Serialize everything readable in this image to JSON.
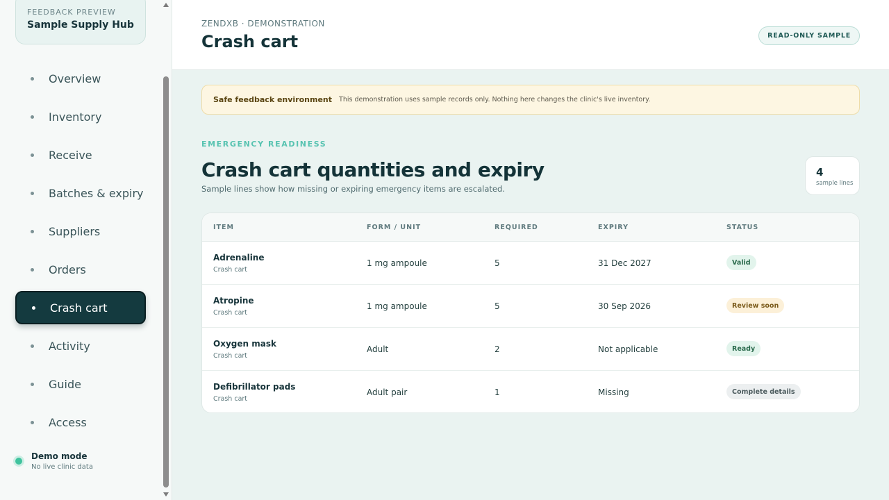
{
  "sidebar": {
    "eyebrow": "FEEDBACK PREVIEW",
    "title": "Sample Supply Hub",
    "items": [
      {
        "label": "Overview"
      },
      {
        "label": "Inventory"
      },
      {
        "label": "Receive"
      },
      {
        "label": "Batches & expiry"
      },
      {
        "label": "Suppliers"
      },
      {
        "label": "Orders"
      },
      {
        "label": "Crash cart",
        "active": true
      },
      {
        "label": "Activity"
      },
      {
        "label": "Guide"
      },
      {
        "label": "Access"
      }
    ],
    "demo": {
      "title": "Demo mode",
      "subtitle": "No live clinic data"
    }
  },
  "header": {
    "breadcrumb": "ZENDXB · DEMONSTRATION",
    "title": "Crash cart",
    "badge": "READ-ONLY SAMPLE"
  },
  "notice": {
    "title": "Safe feedback environment",
    "text": "This demonstration uses sample records only. Nothing here changes the clinic's live inventory."
  },
  "section": {
    "eyebrow": "EMERGENCY READINESS",
    "title": "Crash cart quantities and expiry",
    "subtitle": "Sample lines show how missing or expiring emergency items are escalated.",
    "count": "4",
    "count_label": "sample lines"
  },
  "table": {
    "columns": [
      "ITEM",
      "FORM / UNIT",
      "REQUIRED",
      "EXPIRY",
      "STATUS"
    ],
    "rows": [
      {
        "item": "Adrenaline",
        "sub": "Crash cart",
        "form": "1 mg ampoule",
        "required": "5",
        "expiry": "31 Dec 2027",
        "status": "Valid",
        "tone": "green"
      },
      {
        "item": "Atropine",
        "sub": "Crash cart",
        "form": "1 mg ampoule",
        "required": "5",
        "expiry": "30 Sep 2026",
        "status": "Review soon",
        "tone": "amber"
      },
      {
        "item": "Oxygen mask",
        "sub": "Crash cart",
        "form": "Adult",
        "required": "2",
        "expiry": "Not applicable",
        "status": "Ready",
        "tone": "green"
      },
      {
        "item": "Defibrillator pads",
        "sub": "Crash cart",
        "form": "Adult pair",
        "required": "1",
        "expiry": "Missing",
        "status": "Complete details",
        "tone": "grey"
      }
    ]
  },
  "colors": {
    "accent": "#143a3f",
    "teal": "#58c3b1",
    "notice_bg": "#fdf6e2"
  }
}
